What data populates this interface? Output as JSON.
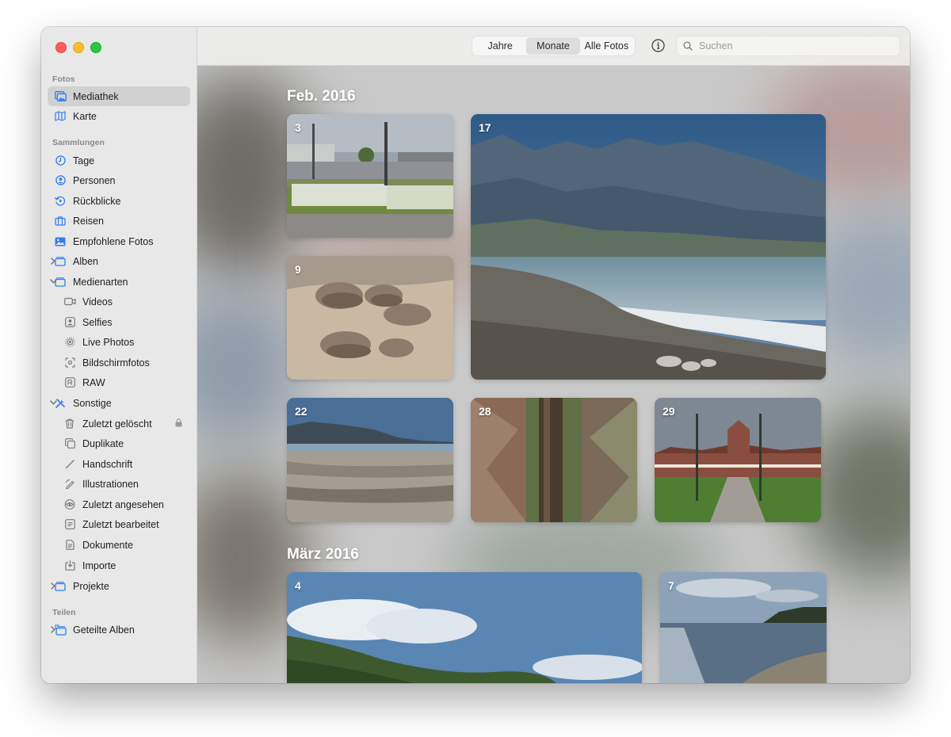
{
  "sidebar": {
    "sections": {
      "fotos": "Fotos",
      "sammlungen": "Sammlungen",
      "teilen": "Teilen"
    },
    "items": {
      "mediathek": "Mediathek",
      "karte": "Karte",
      "tage": "Tage",
      "personen": "Personen",
      "rueckblicke": "Rückblicke",
      "reisen": "Reisen",
      "empfohlene_fotos": "Empfohlene Fotos",
      "alben": "Alben",
      "medienarten": "Medienarten",
      "videos": "Videos",
      "selfies": "Selfies",
      "live_photos": "Live Photos",
      "bildschirmfotos": "Bildschirmfotos",
      "raw": "RAW",
      "sonstige": "Sonstige",
      "zuletzt_geloescht": "Zuletzt gelöscht",
      "duplikate": "Duplikate",
      "handschrift": "Handschrift",
      "illustrationen": "Illustrationen",
      "zuletzt_angesehen": "Zuletzt angesehen",
      "zuletzt_bearbeitet": "Zuletzt bearbeitet",
      "dokumente": "Dokumente",
      "importe": "Importe",
      "projekte": "Projekte",
      "geteilte_alben": "Geteilte Alben"
    },
    "selected": "Mediathek"
  },
  "toolbar": {
    "view_options": [
      "Jahre",
      "Monate",
      "Alle Fotos"
    ],
    "active_view": "Monate",
    "search_placeholder": "Suchen"
  },
  "months": [
    {
      "label": "Feb. 2016",
      "photos": [
        {
          "day": "3",
          "subject": "white chairs memorial on lawn"
        },
        {
          "day": "17",
          "subject": "mountains over pebble beach"
        },
        {
          "day": "9",
          "subject": "round boulders on sand beach"
        },
        {
          "day": "22",
          "subject": "beach with driftwood and hills"
        },
        {
          "day": "28",
          "subject": "tree trunk in forest"
        },
        {
          "day": "29",
          "subject": "historic building with lamp posts"
        }
      ]
    },
    {
      "label": "März 2016",
      "photos": [
        {
          "day": "4",
          "subject": "coastal hill with clouds"
        },
        {
          "day": "7",
          "subject": "sea with sunlight reflections"
        }
      ]
    }
  ],
  "colors": {
    "accent": "#2f7cf6",
    "traffic_red": "#fe5f57",
    "traffic_yellow": "#febc2e",
    "traffic_green": "#28c840"
  }
}
